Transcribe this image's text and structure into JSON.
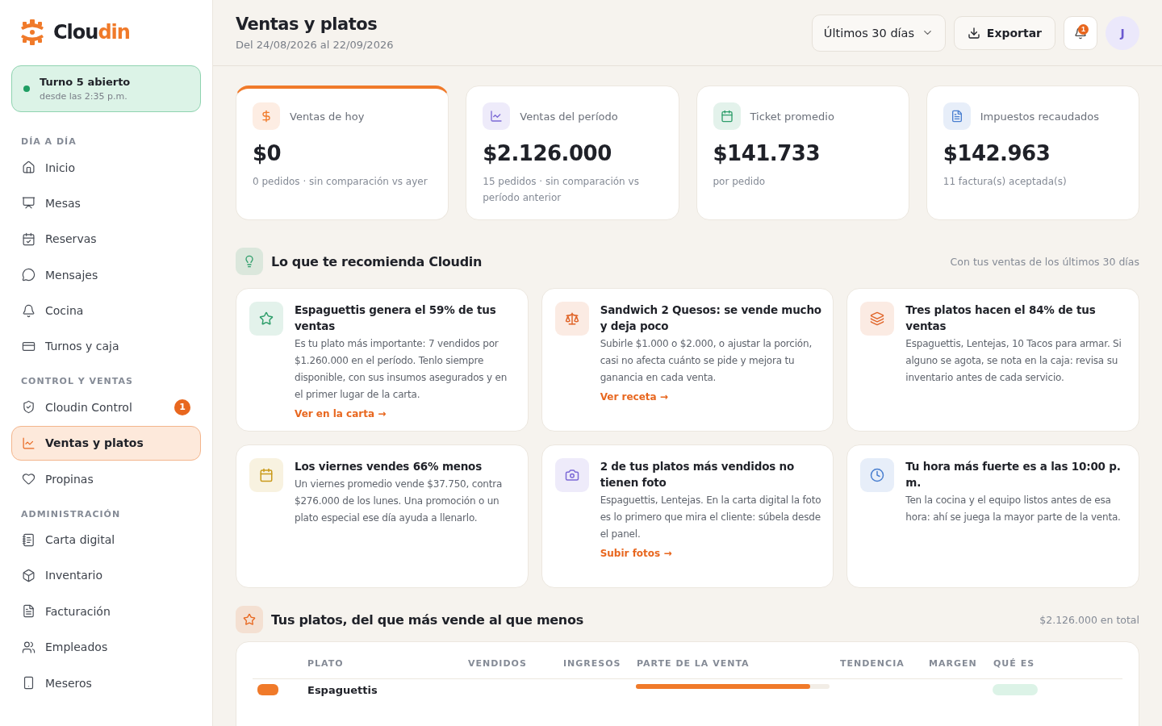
{
  "brand": {
    "name_start": "Clou",
    "name_end": "din"
  },
  "shift": {
    "title": "Turno 5 abierto",
    "subtitle": "desde las 2:35 p.m.",
    "open": true
  },
  "nav_sections": [
    {
      "title": "DÍA A DÍA",
      "items": [
        {
          "label": "Inicio",
          "selected": false
        },
        {
          "label": "Mesas",
          "selected": false
        },
        {
          "label": "Reservas",
          "selected": false
        },
        {
          "label": "Mensajes",
          "selected": false
        },
        {
          "label": "Cocina",
          "selected": false
        },
        {
          "label": "Turnos y caja",
          "selected": false
        }
      ]
    },
    {
      "title": "CONTROL Y VENTAS",
      "items": [
        {
          "label": "Cloudin Control",
          "selected": false,
          "badge": "1"
        },
        {
          "label": "Ventas y platos",
          "selected": true
        },
        {
          "label": "Propinas",
          "selected": false
        }
      ]
    },
    {
      "title": "ADMINISTRACIÓN",
      "items": [
        {
          "label": "Carta digital",
          "selected": false
        },
        {
          "label": "Inventario",
          "selected": false
        },
        {
          "label": "Facturación",
          "selected": false
        },
        {
          "label": "Empleados",
          "selected": false
        },
        {
          "label": "Meseros",
          "selected": false
        }
      ]
    }
  ],
  "header": {
    "title": "Ventas y platos",
    "subtitle": "Del 24/08/2026 al 22/09/2026",
    "period": "Últimos 30 días",
    "export": "Exportar",
    "notifications": "1",
    "avatar": "J"
  },
  "stats": [
    {
      "label": "Ventas de hoy",
      "value": "$0",
      "note": "0 pedidos · sin comparación vs ayer",
      "color": "#f07a2a",
      "highlighted": true
    },
    {
      "label": "Ventas del período",
      "value": "$2.126.000",
      "note": "15 pedidos · sin comparación vs período anterior",
      "color": "#7c6ad6",
      "highlighted": false
    },
    {
      "label": "Ticket promedio",
      "value": "$141.733",
      "note": "por pedido",
      "color": "#2f9e6b",
      "highlighted": false
    },
    {
      "label": "Impuestos recaudados",
      "value": "$142.963",
      "note": "11 factura(s) aceptada(s)",
      "color": "#4a7fd0",
      "highlighted": false
    }
  ],
  "recommendations": {
    "title": "Lo que te recomienda Cloudin",
    "note": "Con tus ventas de los últimos 30 días",
    "cards": [
      {
        "title": "Espaguettis genera el 59% de tus ventas",
        "text": "Es tu plato más importante: 7 vendidos por $1.260.000 en el período. Tenlo siempre disponible, con sus insumos asegurados y en el primer lugar de la carta.",
        "link": "Ver en la carta →",
        "color": "#2f9e6b"
      },
      {
        "title": "Sandwich 2 Quesos: se vende mucho y deja poco",
        "text": "Subirle $1.000 o $2.000, o ajustar la porción, casi no afecta cuánto se pide y mejora tu ganancia en cada venta.",
        "link": "Ver receta →",
        "color": "#e0662a"
      },
      {
        "title": "Tres platos hacen el 84% de tus ventas",
        "text": "Espaguettis, Lentejas, 10 Tacos para armar. Si alguno se agota, se nota en la caja: revisa su inventario antes de cada servicio.",
        "color": "#e0662a"
      },
      {
        "title": "Los viernes vendes 66% menos",
        "text": "Un viernes promedio vende $37.750, contra $276.000 de los lunes. Una promoción o un plato especial ese día ayuda a llenarlo.",
        "color": "#c99a1a"
      },
      {
        "title": "2 de tus platos más vendidos no tienen foto",
        "text": "Espaguettis, Lentejas. En la carta digital la foto es lo primero que mira el cliente: súbela desde el panel.",
        "link": "Subir fotos →",
        "color": "#7c6ad6"
      },
      {
        "title": "Tu hora más fuerte es a las 10:00 p. m.",
        "text": "Ten la cocina y el equipo listos antes de esa hora: ahí se juega la mayor parte de la venta.",
        "color": "#4a7fd0"
      }
    ]
  },
  "dishes": {
    "title": "Tus platos, del que más vende al que menos",
    "total": "$2.126.000 en total",
    "columns": [
      "PLATO",
      "VENDIDOS",
      "INGRESOS",
      "PARTE DE LA VENTA",
      "TENDENCIA",
      "MARGEN",
      "QUÉ ES"
    ],
    "rows": [
      {
        "name": "Espaguettis",
        "level": 0.9
      }
    ]
  }
}
